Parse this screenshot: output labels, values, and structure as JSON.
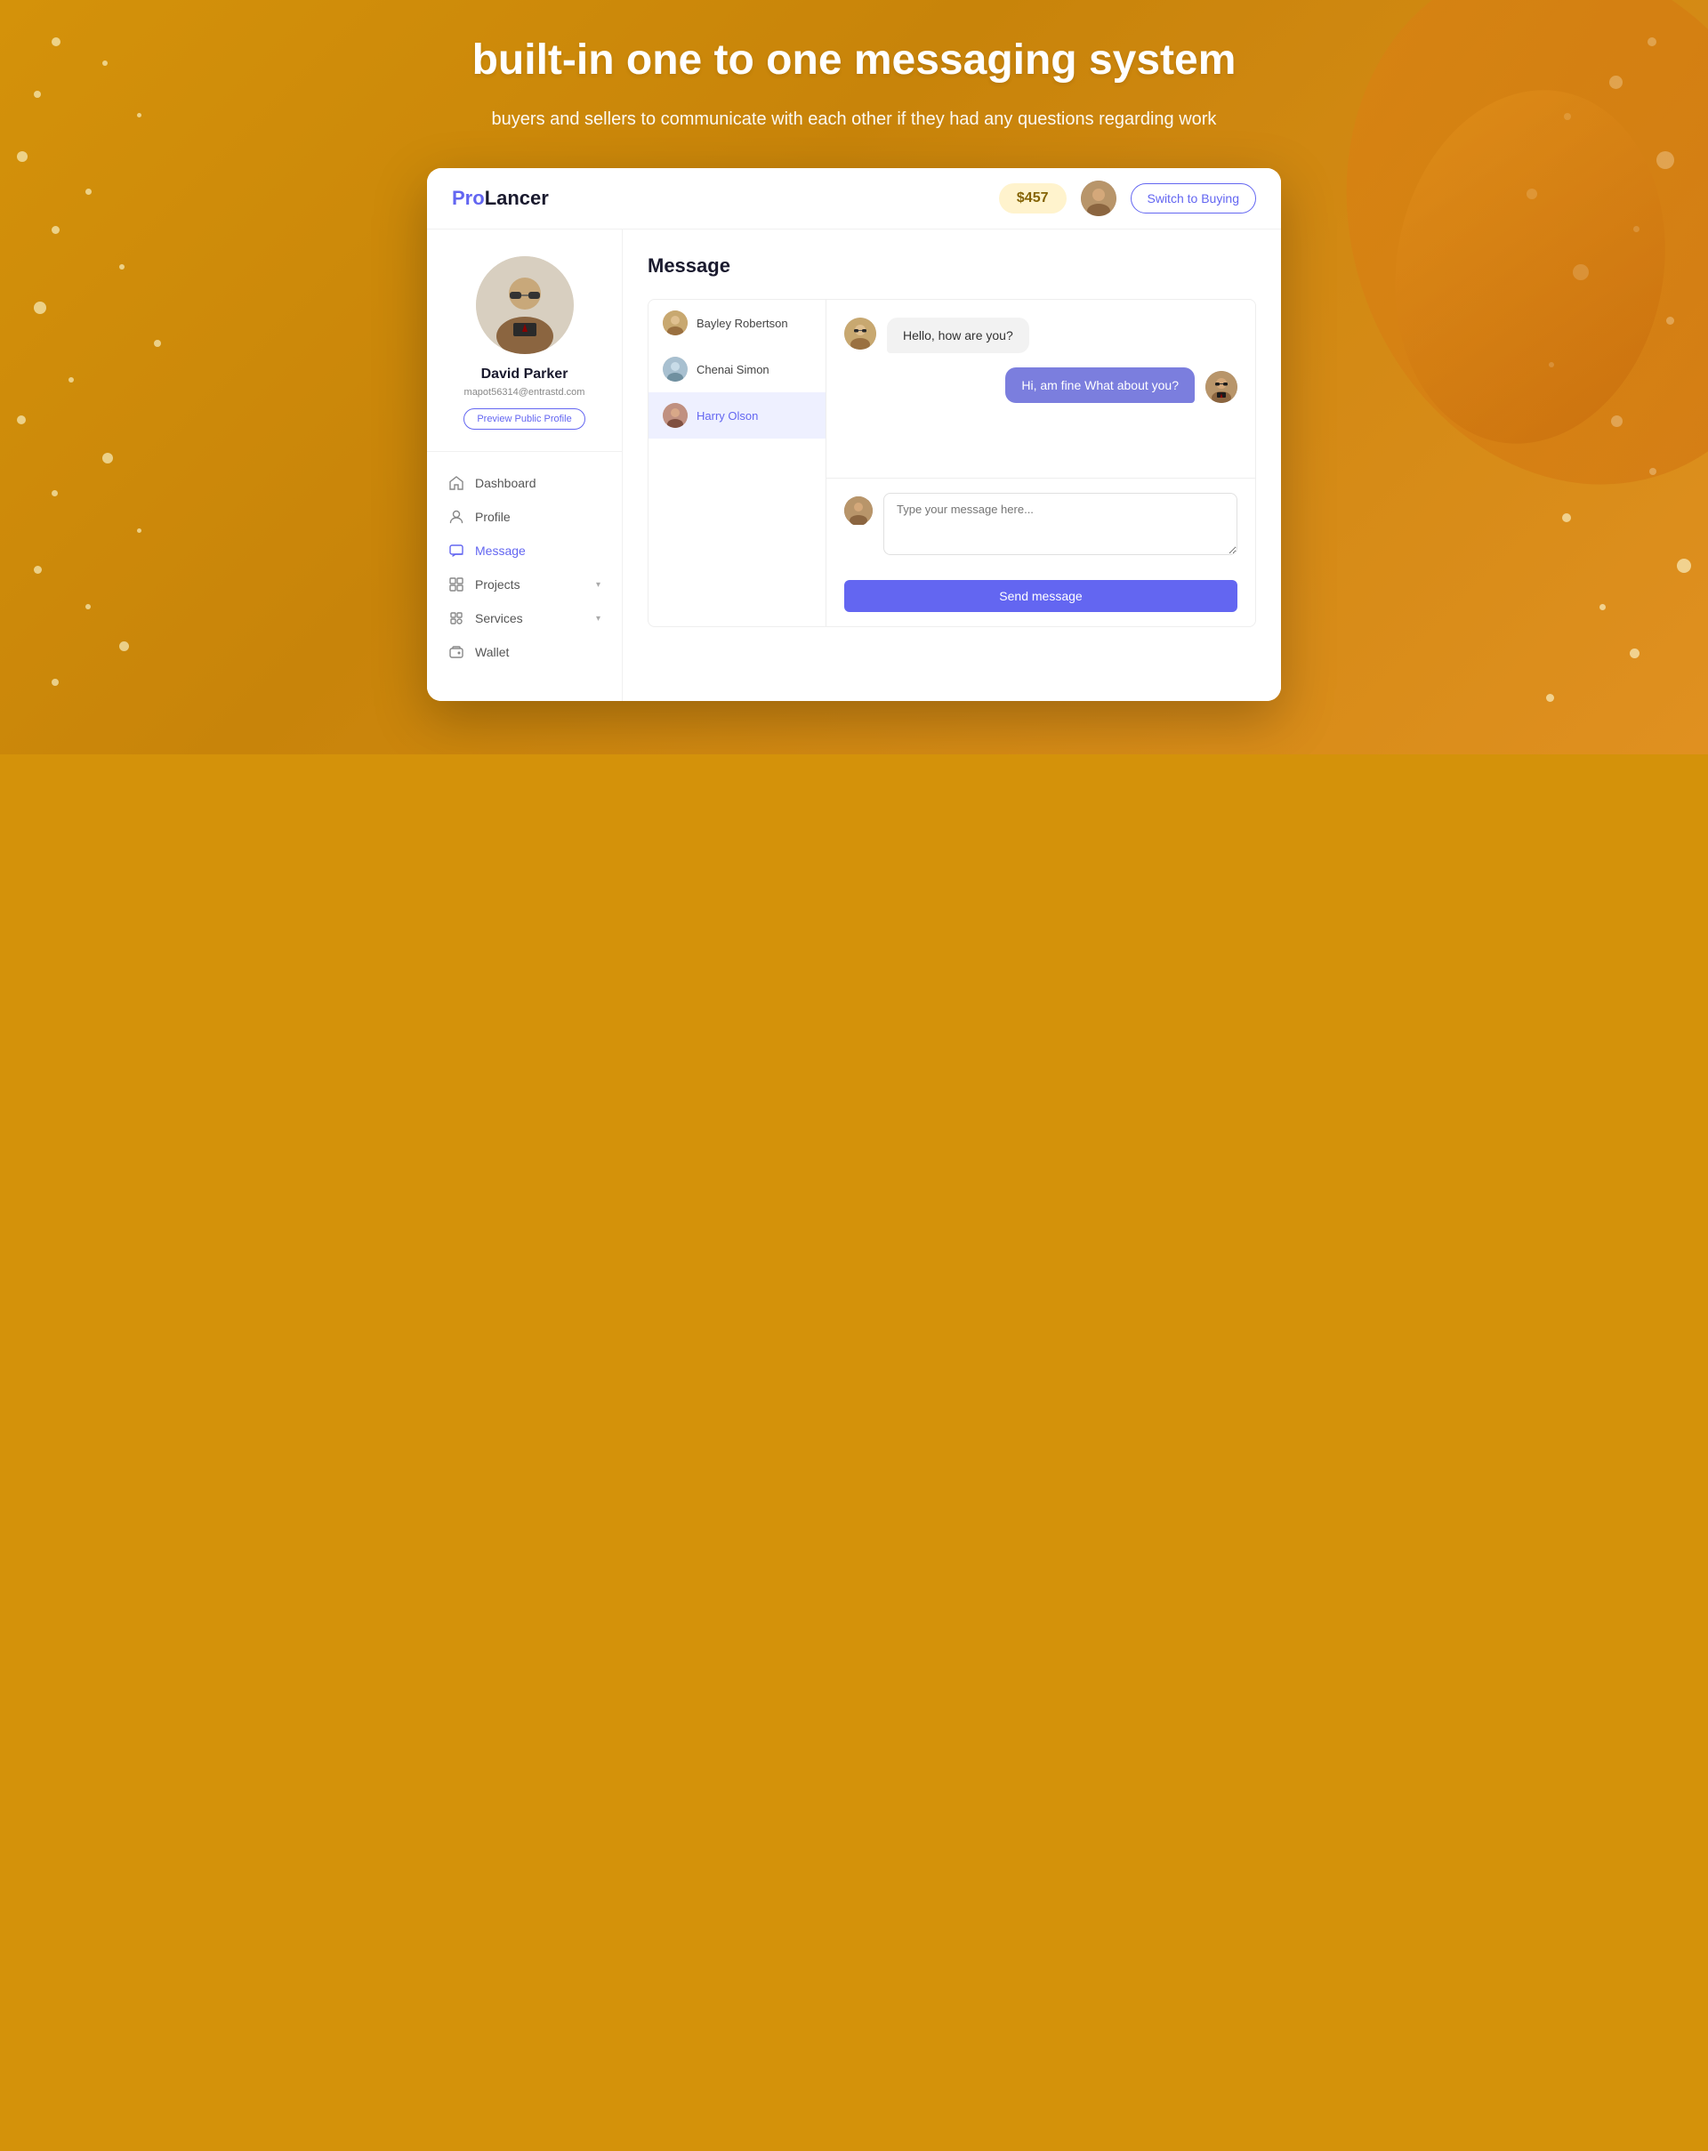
{
  "hero": {
    "title": "built-in one to one messaging system",
    "subtitle": "buyers and sellers to communicate with each other\nif they had any questions regarding work"
  },
  "navbar": {
    "logo_pro": "Pro",
    "logo_lancer": "Lancer",
    "balance": "$457",
    "switch_label": "Switch to Buying"
  },
  "profile": {
    "name": "David Parker",
    "email": "mapot56314@entrastd.com",
    "preview_btn": "Preview Public Profile"
  },
  "nav_items": [
    {
      "label": "Dashboard",
      "icon": "home-icon"
    },
    {
      "label": "Profile",
      "icon": "user-icon"
    },
    {
      "label": "Message",
      "icon": "message-icon",
      "active": true
    },
    {
      "label": "Projects",
      "icon": "projects-icon",
      "has_chevron": true
    },
    {
      "label": "Services",
      "icon": "services-icon",
      "has_chevron": true
    },
    {
      "label": "Wallet",
      "icon": "wallet-icon"
    }
  ],
  "message_title": "Message",
  "contacts": [
    {
      "name": "Bayley Robertson",
      "avatar_color": "#c8a080"
    },
    {
      "name": "Chenai Simon",
      "avatar_color": "#a8c0d0"
    },
    {
      "name": "Harry Olson",
      "avatar_color": "#d0a8a0",
      "active": true
    }
  ],
  "chat_messages": [
    {
      "type": "received",
      "text": "Hello, how are you?",
      "avatar": "👓"
    },
    {
      "type": "sent",
      "text": "Hi, am fine What about you?",
      "avatar": "🕶"
    }
  ],
  "input_placeholder": "Type your message here...",
  "send_button": "Send message"
}
